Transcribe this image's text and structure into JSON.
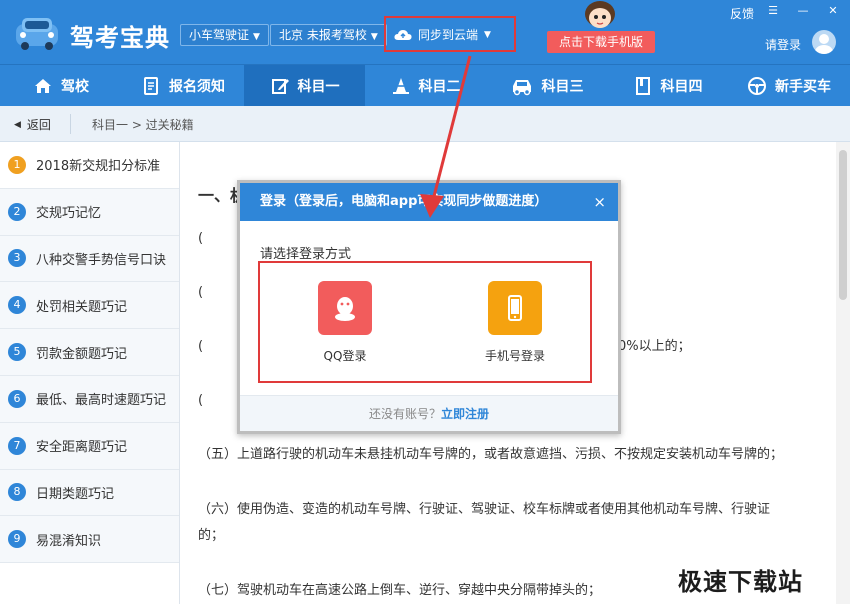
{
  "header": {
    "app_title": "驾考宝典",
    "car_type": "小车驾驶证",
    "location": "北京 未报考驾校",
    "sync_label": "同步到云端",
    "download_label": "点击下载手机版",
    "feedback": "反馈",
    "login_label": "请登录"
  },
  "nav": {
    "items": [
      {
        "label": "驾校",
        "icon": "house-icon"
      },
      {
        "label": "报名须知",
        "icon": "document-icon"
      },
      {
        "label": "科目一",
        "icon": "edit-icon"
      },
      {
        "label": "科目二",
        "icon": "cone-icon"
      },
      {
        "label": "科目三",
        "icon": "car-icon"
      },
      {
        "label": "科目四",
        "icon": "book-icon"
      },
      {
        "label": "新手买车",
        "icon": "steering-wheel-icon"
      }
    ],
    "active_index": 2
  },
  "crumbs": {
    "back": "返回",
    "path": "科目一 > 过关秘籍"
  },
  "sidebar": {
    "items": [
      {
        "num": "1",
        "label": "2018新交规扣分标准"
      },
      {
        "num": "2",
        "label": "交规巧记忆"
      },
      {
        "num": "3",
        "label": "八种交警手势信号口诀"
      },
      {
        "num": "4",
        "label": "处罚相关题巧记"
      },
      {
        "num": "5",
        "label": "罚款金额题巧记"
      },
      {
        "num": "6",
        "label": "最低、最高时速题巧记"
      },
      {
        "num": "7",
        "label": "安全距离题巧记"
      },
      {
        "num": "8",
        "label": "日期类题巧记"
      },
      {
        "num": "9",
        "label": "易混淆知识"
      }
    ]
  },
  "content": {
    "heading_visible": "一、机",
    "fragments": [
      "(",
      "(",
      "(",
      "("
    ],
    "partial_right": "0%以上的；",
    "p5": "（五）上道路行驶的机动车未悬挂机动车号牌的，或者故意遮挡、污损、不按规定安装机动车号牌的；",
    "p6a": "（六）使用伪造、变造的机动车号牌、行驶证、驾驶证、校车标牌或者使用其他机动车号牌、行驶证",
    "p6b": "的；",
    "p7": "（七）驾驶机动车在高速公路上倒车、逆行、穿越中央分隔带掉头的；"
  },
  "modal": {
    "title": "登录（登录后，电脑和app可实现同步做题进度）",
    "subtitle": "请选择登录方式",
    "qq_label": "QQ登录",
    "phone_label": "手机号登录",
    "footer_text": "还没有账号？",
    "register": "立即注册",
    "close": "×"
  },
  "watermark": "极速下载站",
  "colors": {
    "primary": "#2f86d8",
    "highlight": "#e03a3a",
    "qq": "#f25c5c",
    "phone": "#f5a20f"
  }
}
